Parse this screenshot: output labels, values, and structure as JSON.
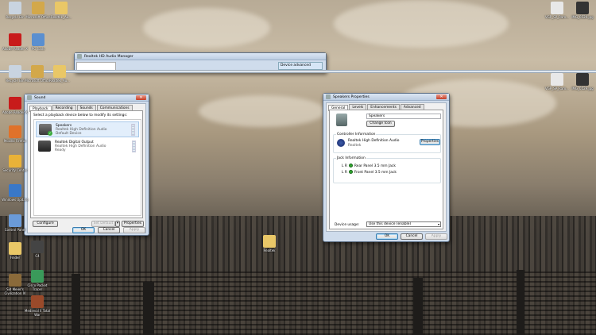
{
  "desktop": {
    "icons_left_top": [
      {
        "label": "Recycle Bin",
        "icon": "recycle-bin-icon",
        "color": "#c9d4e0"
      },
      {
        "label": "Microsoft Office",
        "icon": "office-icon",
        "color": "#d3a84a"
      },
      {
        "label": "Realtek_Au...",
        "icon": "folder-icon",
        "color": "#e9c767"
      }
    ],
    "icons_left_row2": [
      {
        "label": "Adobe Reader X",
        "icon": "adobe-reader-icon",
        "color": "#c81b1b"
      },
      {
        "label": "PC Tools",
        "icon": "pc-tools-icon",
        "color": "#5a8fd0"
      }
    ],
    "icons_left_lower": [
      {
        "label": "Recycle Bin",
        "icon": "recycle-bin-icon",
        "color": "#c9d4e0"
      },
      {
        "label": "Microsoft Office",
        "icon": "office-icon",
        "color": "#d3a84a"
      },
      {
        "label": "Realtek_Au...",
        "icon": "folder-icon",
        "color": "#e9c767"
      },
      {
        "label": "Adobe Reader X",
        "icon": "adobe-reader-icon",
        "color": "#c81b1b"
      },
      {
        "label": "Mozilla Firefox",
        "icon": "firefox-icon",
        "color": "#e0722a"
      },
      {
        "label": "Security Center",
        "icon": "security-center-icon",
        "color": "#e9b238"
      },
      {
        "label": "Windows Update",
        "icon": "windows-update-icon",
        "color": "#3a78c8"
      },
      {
        "label": "Control Panel",
        "icon": "control-panel-icon",
        "color": "#6a9ad8"
      },
      {
        "label": "Finder",
        "icon": "folder-icon",
        "color": "#e9c767"
      },
      {
        "label": "Sid Meier's Civilization IV",
        "icon": "civilization-icon",
        "color": "#8a6a3a"
      }
    ],
    "icons_mid": [
      {
        "label": "C4",
        "icon": "c4-icon",
        "color": "#444444"
      },
      {
        "label": "Cisco Packet Tracer",
        "icon": "packet-tracer-icon",
        "color": "#3a9a5a"
      },
      {
        "label": "Medieval II Total War",
        "icon": "total-war-icon",
        "color": "#9a4a2a"
      }
    ],
    "icons_right": [
      {
        "label": "VGP_SP_Ram...",
        "icon": "document-icon",
        "color": "#e8e8e8"
      },
      {
        "label": "IMG_0529.jpg",
        "icon": "image-icon",
        "color": "#333333"
      }
    ],
    "center_folder": {
      "label": "Realtek",
      "icon": "folder-icon",
      "color": "#e9c767"
    }
  },
  "hd_audio_manager": {
    "title": "Realtek HD Audio Manager",
    "status": "Device advanced"
  },
  "sound_dialog": {
    "title": "Sound",
    "tabs": [
      "Playback",
      "Recording",
      "Sounds",
      "Communications"
    ],
    "active_tab": "Playback",
    "instruction": "Select a playback device below to modify its settings:",
    "devices": [
      {
        "name": "Speakers",
        "driver": "Realtek High Definition Audio",
        "status": "Default Device",
        "icon": "speaker-icon"
      },
      {
        "name": "Realtek Digital Output",
        "driver": "Realtek High Definition Audio",
        "status": "Ready",
        "icon": "digital-output-icon"
      }
    ],
    "configure_label": "Configure",
    "set_default_label": "Set Default",
    "properties_label": "Properties",
    "ok_label": "OK",
    "cancel_label": "Cancel",
    "apply_label": "Apply"
  },
  "speakers_props": {
    "title": "Speakers Properties",
    "tabs": [
      "General",
      "Levels",
      "Enhancements",
      "Advanced"
    ],
    "active_tab": "General",
    "name_value": "Speakers",
    "change_icon_label": "Change Icon",
    "controller_header": "Controller Information",
    "controller_name": "Realtek High Definition Audio",
    "controller_vendor": "Realtek",
    "controller_properties_label": "Properties",
    "jack_header": "Jack Information",
    "jacks": [
      {
        "channel": "L R",
        "label": "Rear Panel 3.5 mm Jack"
      },
      {
        "channel": "L R",
        "label": "Front Panel 3.5 mm Jack"
      }
    ],
    "device_usage_label": "Device usage:",
    "device_usage_value": "Use this device (enable)",
    "ok_label": "OK",
    "cancel_label": "Cancel",
    "apply_label": "Apply"
  }
}
